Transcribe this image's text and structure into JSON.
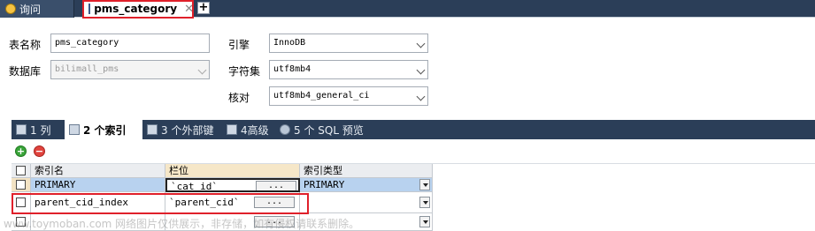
{
  "doc_tabs": {
    "query_tab": "询问",
    "table_tab": "pms_category",
    "close_glyph": "✕",
    "add_glyph": "+"
  },
  "form": {
    "table_name_label": "表名称",
    "table_name_value": "pms_category",
    "database_label": "数据库",
    "database_value": "bilimall_pms",
    "engine_label": "引擎",
    "engine_value": "InnoDB",
    "charset_label": "字符集",
    "charset_value": "utf8mb4",
    "collation_label": "核对",
    "collation_value": "utf8mb4_general_ci"
  },
  "sub_tabs": [
    "1 列",
    "2 个索引",
    "3 个外部键",
    "4高级",
    "5 个 SQL 预览"
  ],
  "active_sub_tab": 1,
  "toolbar": {
    "add_glyph": "+",
    "remove_glyph": "−"
  },
  "grid": {
    "headers": [
      "索引名",
      "栏位",
      "索引类型"
    ],
    "rows": [
      {
        "name": "PRIMARY",
        "columns": "`cat_id`",
        "type": "PRIMARY",
        "button": "..."
      },
      {
        "name": "parent_cid_index",
        "columns": "`parent_cid`",
        "type": "",
        "button": "..."
      },
      {
        "name": "",
        "columns": "",
        "type": "",
        "button": "..."
      }
    ]
  },
  "watermark": "www.toymoban.com 网络图片仅供展示，非存储，如有侵权请联系删除。",
  "colors": {
    "tab_strip": "#2b3e58",
    "highlight": "#e0202a",
    "selected_cell": "#b8d2ef"
  }
}
